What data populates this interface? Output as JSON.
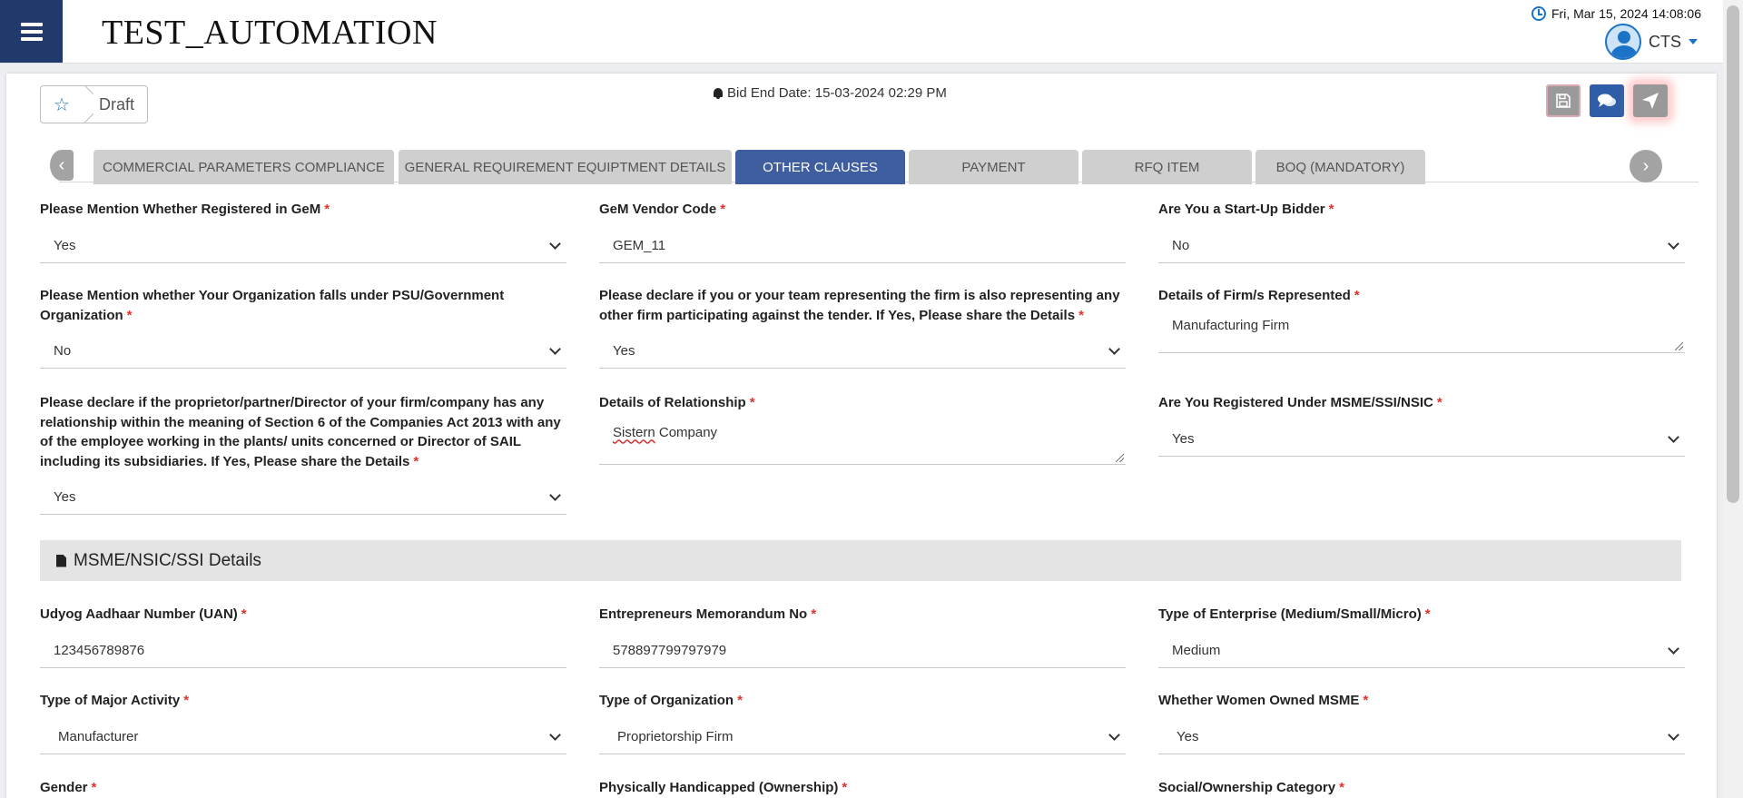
{
  "header": {
    "app_title": "TEST_AUTOMATION",
    "datetime": "Fri, Mar 15, 2024 14:08:06",
    "user_name": "CTS",
    "icons": [
      "menu-icon",
      "clock-icon",
      "avatar",
      "chevron-down-icon"
    ]
  },
  "toolbar": {
    "status": "Draft",
    "bid_end": "Bid End Date: 15-03-2024 02:29 PM",
    "actions": [
      "save-icon",
      "chat-icon",
      "send-icon"
    ]
  },
  "tabs": [
    {
      "label": "COMMERCIAL PARAMETERS COMPLIANCE",
      "active": false
    },
    {
      "label": "GENERAL REQUIREMENT EQUIPTMENT DETAILS",
      "active": false
    },
    {
      "label": "OTHER CLAUSES",
      "active": true
    },
    {
      "label": "PAYMENT",
      "active": false
    },
    {
      "label": "RFQ ITEM",
      "active": false
    },
    {
      "label": "BOQ (MANDATORY)",
      "active": false
    }
  ],
  "form": {
    "registered_gem": {
      "label": "Please Mention Whether Registered in GeM",
      "value": "Yes"
    },
    "gem_vendor_code": {
      "label": "GeM Vendor Code",
      "value": "GEM_11"
    },
    "startup_bidder": {
      "label": "Are You a Start-Up Bidder",
      "value": "No"
    },
    "psu_org": {
      "label": "Please Mention whether Your Organization falls under PSU/Government Organization",
      "value": "No"
    },
    "representing_firm": {
      "label": "Please declare if you or your team representing the firm is also representing any other firm participating against the tender. If Yes, Please share the Details",
      "value": "Yes"
    },
    "firms_represented": {
      "label": "Details of Firm/s Represented",
      "value": "Manufacturing Firm"
    },
    "relationship_sail": {
      "label": "Please declare if the proprietor/partner/Director of your firm/company has any relationship within the meaning of Section 6 of the Companies Act 2013 with any of the employee working in the plants/ units concerned or Director of SAIL including its subsidiaries. If Yes, Please share the Details",
      "value": "Yes"
    },
    "relationship_details": {
      "label": "Details of Relationship",
      "value_word1": "Sistern",
      "value_word2": " Company"
    },
    "msme_registered": {
      "label": "Are You Registered Under MSME/SSI/NSIC",
      "value": "Yes"
    }
  },
  "msme_section": {
    "title": "MSME/NSIC/SSI Details",
    "uan": {
      "label": "Udyog Aadhaar Number (UAN)",
      "value": "123456789876"
    },
    "em_no": {
      "label": "Entrepreneurs Memorandum No",
      "value": "578897799797979"
    },
    "enterprise_type": {
      "label": "Type of Enterprise (Medium/Small/Micro)",
      "value": "Medium"
    },
    "major_activity": {
      "label": "Type of Major Activity",
      "value": "Manufacturer"
    },
    "org_type": {
      "label": "Type of Organization",
      "value": "Proprietorship Firm"
    },
    "women_owned": {
      "label": "Whether Women Owned MSME",
      "value": "Yes"
    },
    "gender": {
      "label": "Gender"
    },
    "handicapped": {
      "label": "Physically Handicapped (Ownership)"
    },
    "social_category": {
      "label": "Social/Ownership Category"
    }
  }
}
